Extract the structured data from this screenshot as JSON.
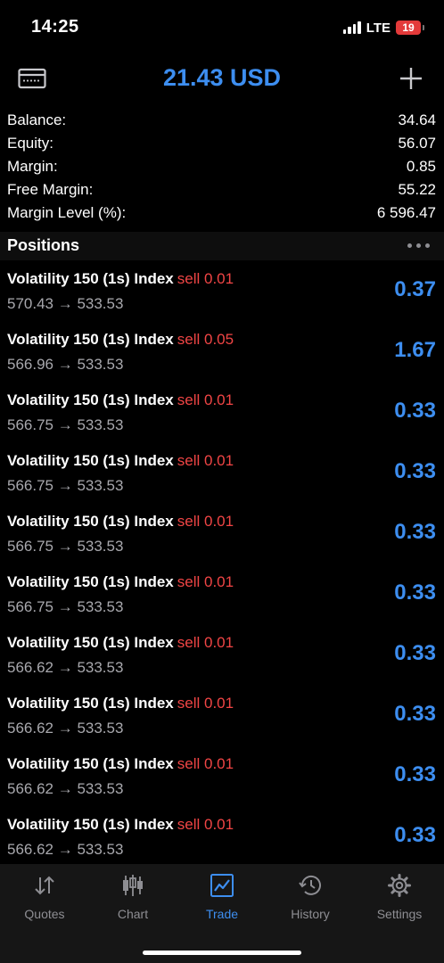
{
  "status_bar": {
    "time": "14:25",
    "network": "LTE",
    "battery": "19"
  },
  "header": {
    "title": "21.43 USD",
    "left_icon": "account-card-icon",
    "right_icon": "plus-icon"
  },
  "summary": [
    {
      "label": "Balance:",
      "value": "34.64"
    },
    {
      "label": "Equity:",
      "value": "56.07"
    },
    {
      "label": "Margin:",
      "value": "0.85"
    },
    {
      "label": "Free Margin:",
      "value": "55.22"
    },
    {
      "label": "Margin Level (%):",
      "value": "6 596.47"
    }
  ],
  "positions": {
    "title": "Positions",
    "items": [
      {
        "symbol": "Volatility 150 (1s) Index",
        "side": "sell 0.01",
        "prices": "570.43 → 533.53",
        "profit": "0.37"
      },
      {
        "symbol": "Volatility 150 (1s) Index",
        "side": "sell 0.05",
        "prices": "566.96 → 533.53",
        "profit": "1.67"
      },
      {
        "symbol": "Volatility 150 (1s) Index",
        "side": "sell 0.01",
        "prices": "566.75 → 533.53",
        "profit": "0.33"
      },
      {
        "symbol": "Volatility 150 (1s) Index",
        "side": "sell 0.01",
        "prices": "566.75 → 533.53",
        "profit": "0.33"
      },
      {
        "symbol": "Volatility 150 (1s) Index",
        "side": "sell 0.01",
        "prices": "566.75 → 533.53",
        "profit": "0.33"
      },
      {
        "symbol": "Volatility 150 (1s) Index",
        "side": "sell 0.01",
        "prices": "566.75 → 533.53",
        "profit": "0.33"
      },
      {
        "symbol": "Volatility 150 (1s) Index",
        "side": "sell 0.01",
        "prices": "566.62 → 533.53",
        "profit": "0.33"
      },
      {
        "symbol": "Volatility 150 (1s) Index",
        "side": "sell 0.01",
        "prices": "566.62 → 533.53",
        "profit": "0.33"
      },
      {
        "symbol": "Volatility 150 (1s) Index",
        "side": "sell 0.01",
        "prices": "566.62 → 533.53",
        "profit": "0.33"
      },
      {
        "symbol": "Volatility 150 (1s) Index",
        "side": "sell 0.01",
        "prices": "566.62 → 533.53",
        "profit": "0.33"
      }
    ]
  },
  "tabs": [
    {
      "label": "Quotes",
      "icon": "quotes-arrows-icon",
      "active": false
    },
    {
      "label": "Chart",
      "icon": "candlestick-chart-icon",
      "active": false
    },
    {
      "label": "Trade",
      "icon": "trade-chart-icon",
      "active": true
    },
    {
      "label": "History",
      "icon": "history-clock-icon",
      "active": false
    },
    {
      "label": "Settings",
      "icon": "gear-icon",
      "active": false
    }
  ],
  "colors": {
    "accent": "#3d8ef0",
    "sell": "#f04545",
    "muted": "#a8a8ad",
    "battery_low": "#e33a3a"
  }
}
